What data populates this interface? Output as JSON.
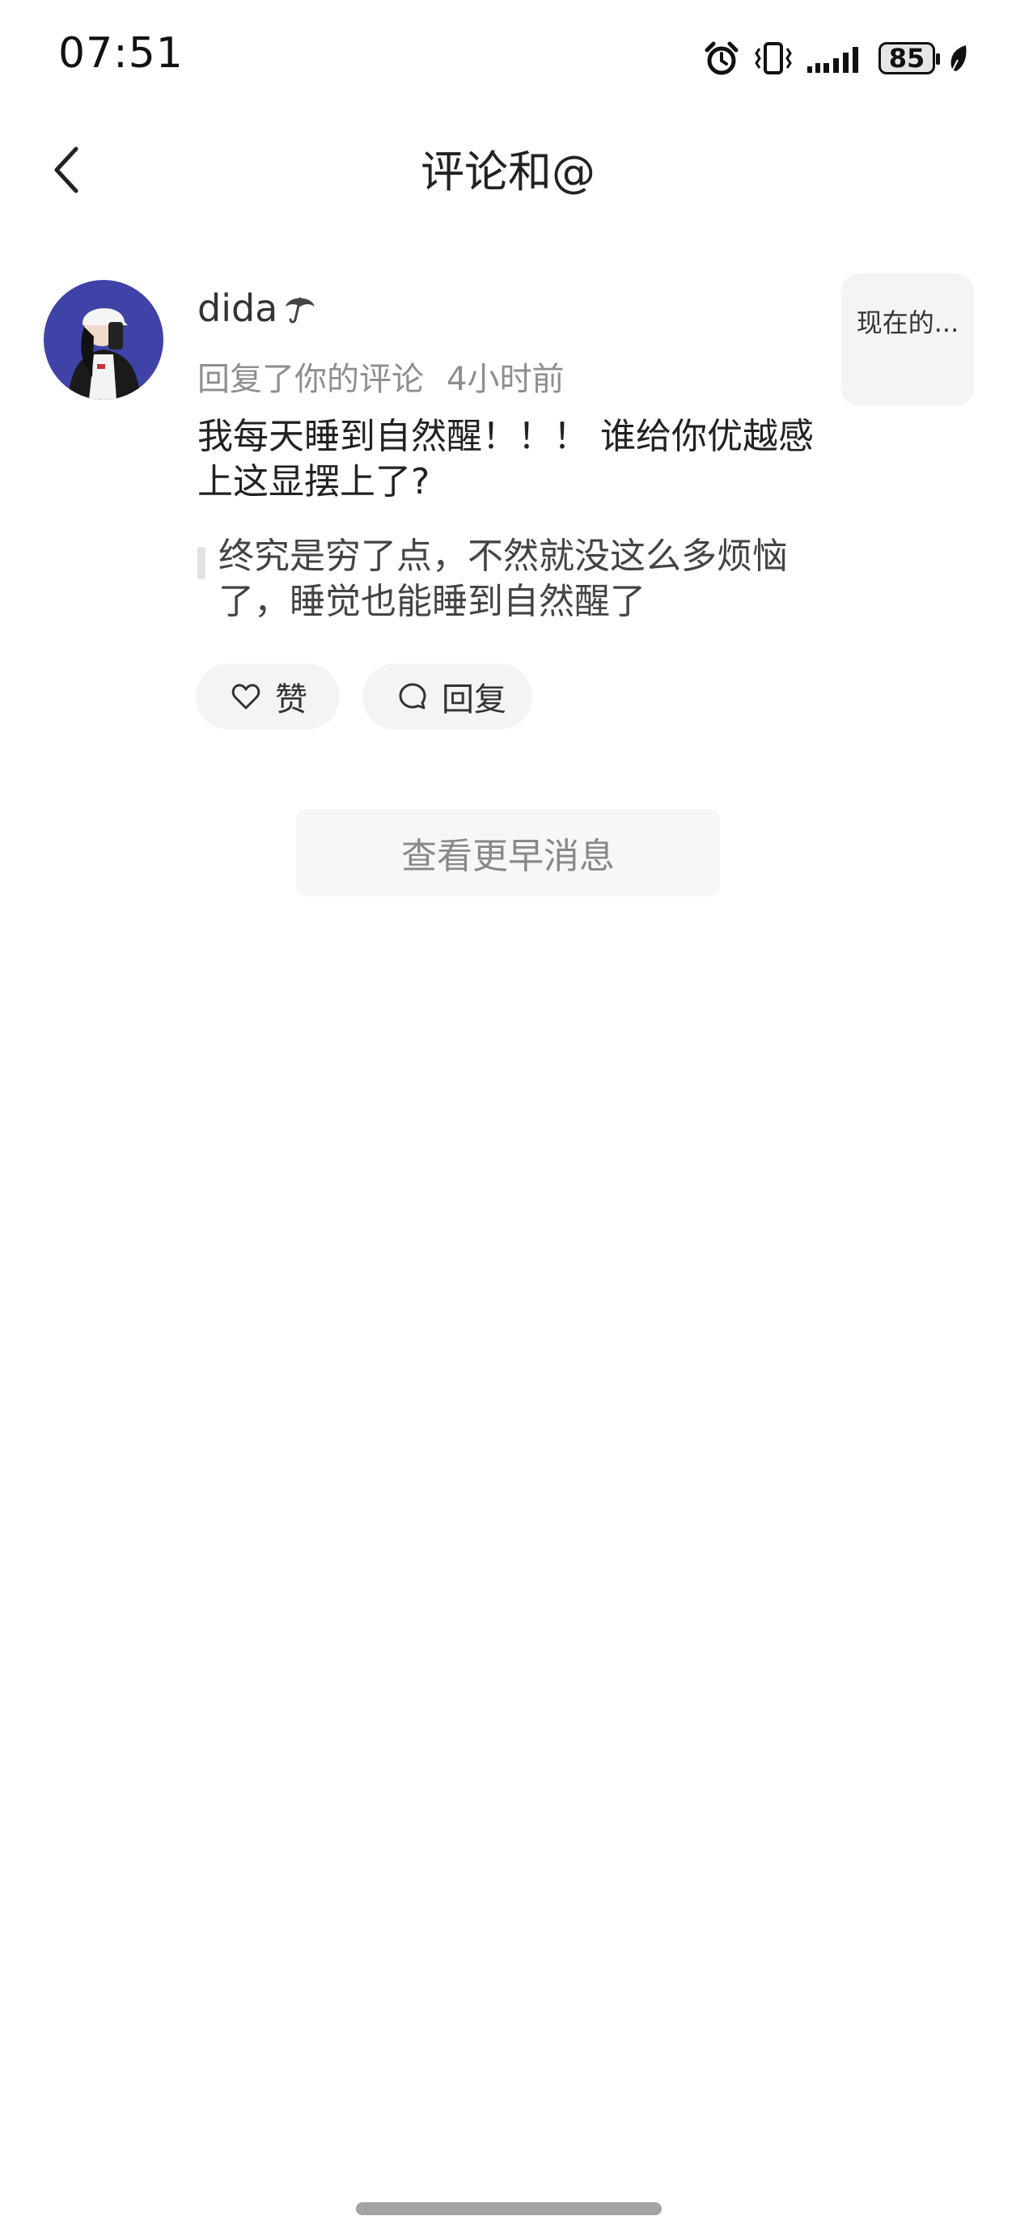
{
  "status_bar": {
    "time": "07:51",
    "battery": "85"
  },
  "header": {
    "title": "评论和@"
  },
  "notification": {
    "username": "dida",
    "action": "回复了你的评论",
    "time_ago": "4小时前",
    "reply_text": "我每天睡到自然醒！！！ 谁给你优越感上这显摆上了?",
    "quoted_text": "终究是穷了点，不然就没这么多烦恼了，睡觉也能睡到自然醒了",
    "post_preview": "现在的...",
    "like_label": "赞",
    "reply_label": "回复"
  },
  "load_more_label": "查看更早消息",
  "colors": {
    "avatar_bg": "#3f43a8",
    "meta_text": "#8e8e8e",
    "pill_bg": "#f4f4f4"
  }
}
